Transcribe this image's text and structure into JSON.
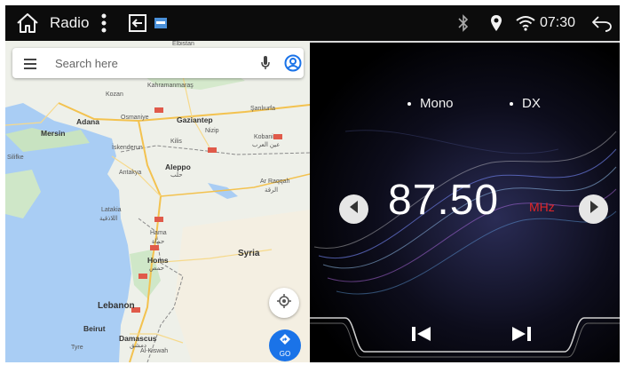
{
  "statusbar": {
    "title": "Radio",
    "time": "07:30",
    "icons": {
      "home": "home-icon",
      "more": "more-vert-icon",
      "split": "split-screen-icon",
      "window": "window-icon",
      "bluetooth": "bluetooth-icon",
      "location": "location-pin-icon",
      "wifi": "wifi-icon",
      "back": "back-icon"
    }
  },
  "map": {
    "search_placeholder": "Search here",
    "go_label": "GO",
    "labels": {
      "ellistan": "Elbistan",
      "kahramanmaras": "Kahramanmaraş",
      "kozan": "Kozan",
      "osmaniye": "Osmaniye",
      "gaziantep": "Gaziantep",
      "sanliurfa": "Şanlıurfa",
      "adana": "Adana",
      "mersin": "Mersin",
      "nizip": "Nizip",
      "iskenderun": "İskenderun",
      "kilis": "Kilis",
      "kobani": "Kobani",
      "kobani_ar": "عين العرب",
      "silifke": "Silifke",
      "antakya": "Antakya",
      "aleppo": "Aleppo",
      "aleppo_ar": "حلب",
      "ar_raqqah": "Ar Raqqah",
      "ar_raqqah_ar": "الرقة",
      "latakia": "Latakia",
      "latakia_ar": "اللاذقية",
      "hama": "Hama",
      "hama_ar": "حماة",
      "homs": "Homs",
      "homs_ar": "حمص",
      "syria": "Syria",
      "lebanon": "Lebanon",
      "beirut": "Beirut",
      "damascus": "Damascus",
      "damascus_ar": "دمشق",
      "tyre": "Tyre",
      "al_kiswah": "Al-Kiswah"
    }
  },
  "radio": {
    "options": [
      "Mono",
      "DX"
    ],
    "frequency": "87.50",
    "unit": "MHz",
    "accent_color": "#e0262a"
  }
}
